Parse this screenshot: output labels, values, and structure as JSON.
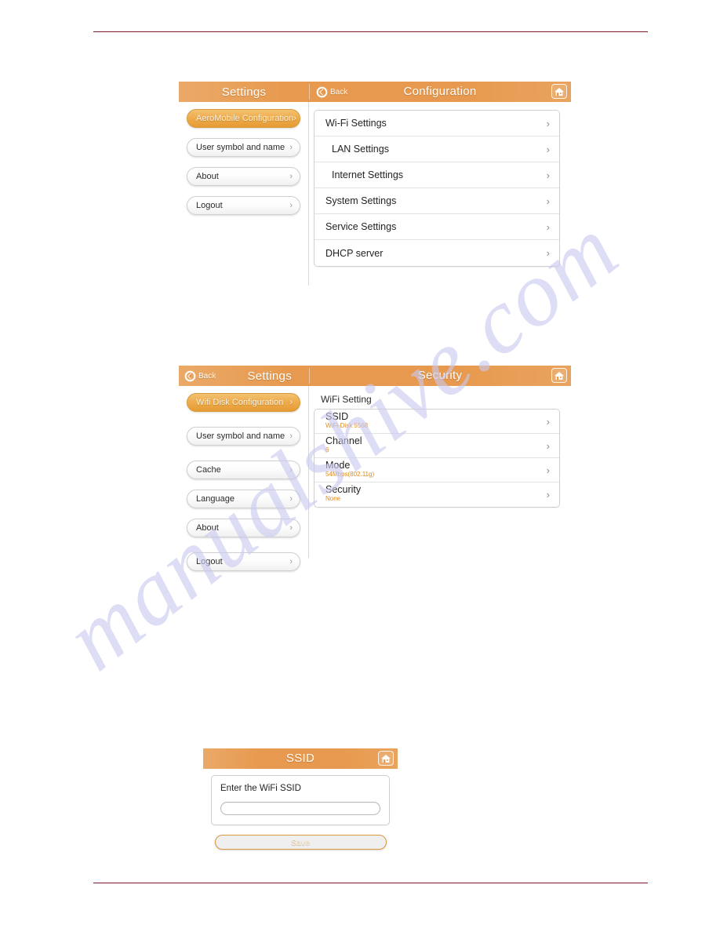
{
  "watermark": {
    "text": "manualshive.com"
  },
  "colors": {
    "header_orange": "#e79a4f",
    "header_orange_light": "#eaa968",
    "accent_value": "#e08a1e",
    "rule_maroon": "#7b1a2b",
    "active_pill": "#eeab4b"
  },
  "shots": {
    "configuration": {
      "titlebar": {
        "left_title": "Settings",
        "back_label": "Back",
        "back_icon": "back-circle-icon",
        "center_title": "Configuration",
        "home_icon": "home-icon"
      },
      "sidebar": [
        {
          "label": "AeroMobile Configuration",
          "active": true,
          "chevron": "›"
        },
        {
          "label": "User symbol and name",
          "active": false,
          "chevron": "›"
        },
        {
          "label": "About",
          "active": false,
          "chevron": "›"
        },
        {
          "label": "Logout",
          "active": false,
          "chevron": "›"
        }
      ],
      "list": [
        {
          "title": "Wi-Fi Settings",
          "chevron": "›",
          "indent": false
        },
        {
          "title": "LAN Settings",
          "chevron": "›",
          "indent": true
        },
        {
          "title": "Internet Settings",
          "chevron": "›",
          "indent": true
        },
        {
          "title": "System Settings",
          "chevron": "›",
          "indent": false
        },
        {
          "title": "Service Settings",
          "chevron": "›",
          "indent": false
        },
        {
          "title": "DHCP server",
          "chevron": "›",
          "indent": false
        }
      ]
    },
    "security": {
      "titlebar": {
        "back_label": "Back",
        "back_icon": "back-circle-icon",
        "left_title": "Settings",
        "center_title": "Security",
        "home_icon": "home-icon"
      },
      "sidebar": [
        {
          "label": "Wifi Disk Configuration",
          "active": true,
          "chevron": "›"
        },
        {
          "label": "User symbol and name",
          "active": false,
          "chevron": "›"
        },
        {
          "label": "Cache",
          "active": false,
          "chevron": "›"
        },
        {
          "label": "Language",
          "active": false,
          "chevron": "›"
        },
        {
          "label": "About",
          "active": false,
          "chevron": "›"
        },
        {
          "label": "Logout",
          "active": false,
          "chevron": "›"
        }
      ],
      "section_label": "WiFi Setting",
      "list": [
        {
          "title": "SSID",
          "value": "WiFi-Disk 5568",
          "chevron": "›"
        },
        {
          "title": "Channel",
          "value": "6",
          "chevron": "›"
        },
        {
          "title": "Mode",
          "value": "54Mbps(802.11g)",
          "chevron": "›"
        },
        {
          "title": "Security",
          "value": "None",
          "chevron": "›"
        }
      ]
    },
    "ssid_dialog": {
      "titlebar": {
        "center_title": "SSID",
        "home_icon": "home-icon"
      },
      "field_label": "Enter the WiFi SSID",
      "field_value": "",
      "field_placeholder": "",
      "save_label": "Save"
    }
  }
}
